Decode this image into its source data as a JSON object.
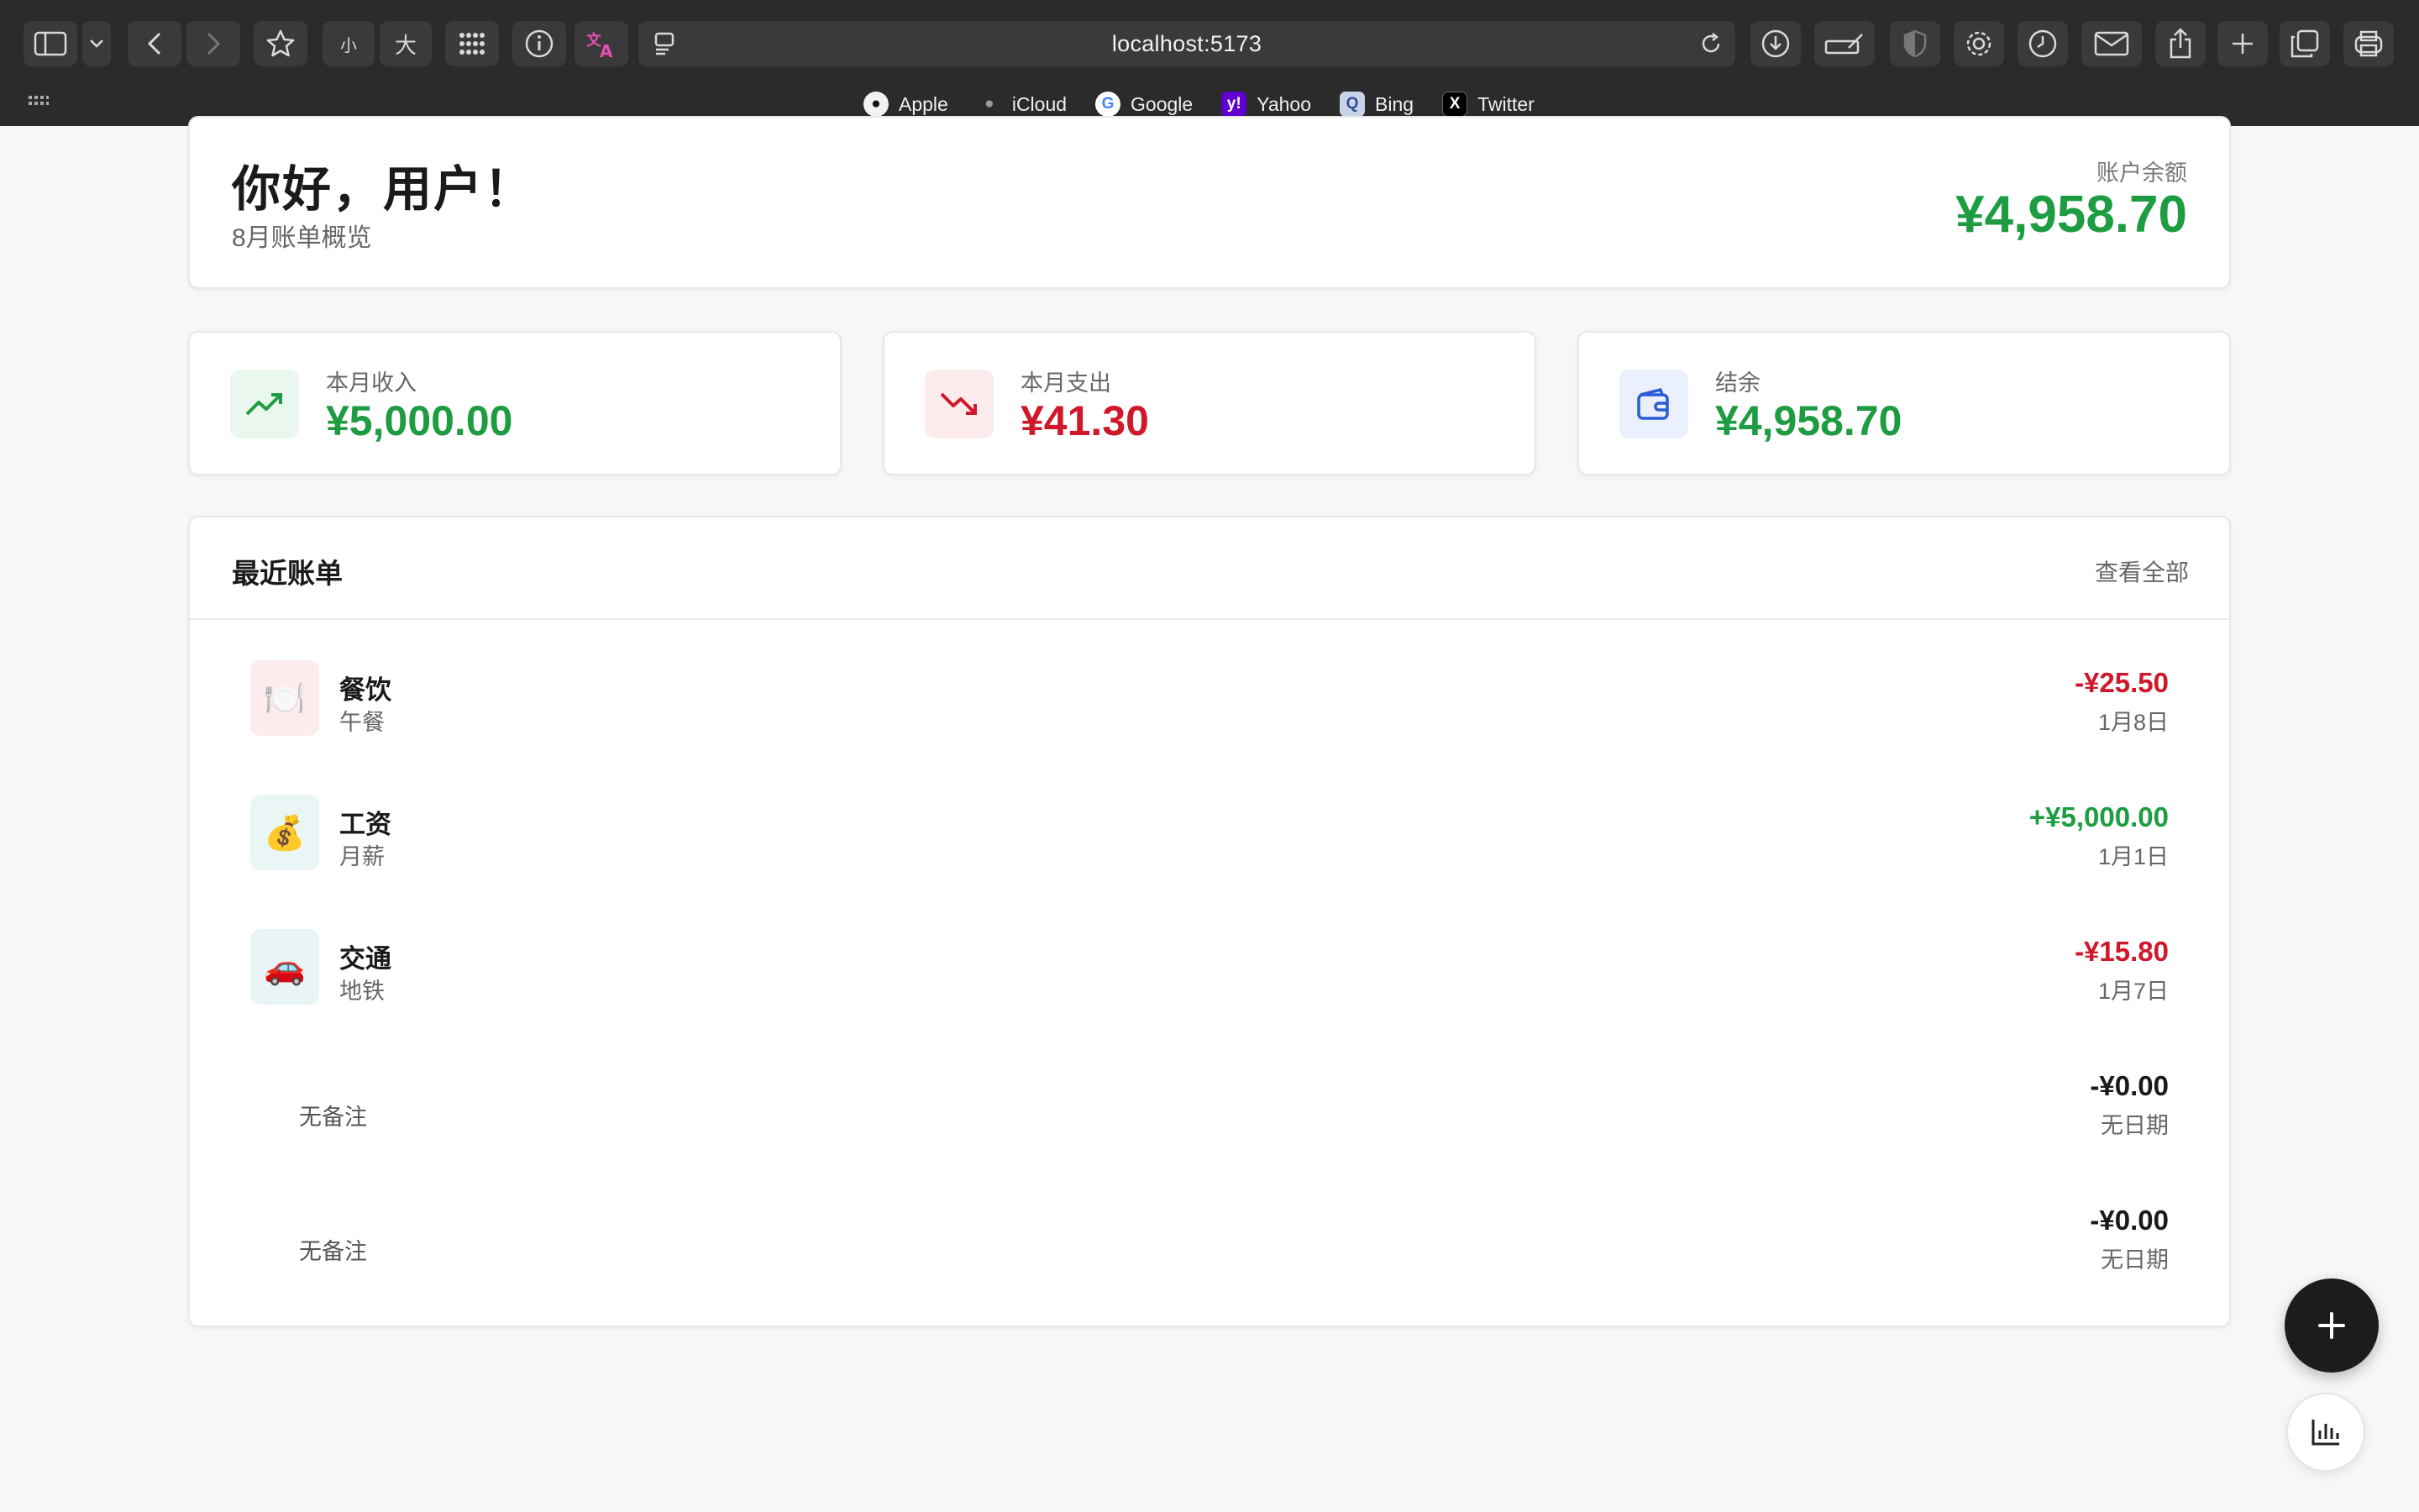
{
  "browser": {
    "url": "localhost:5173",
    "font_small_label": "小",
    "font_large_label": "大",
    "favorites": [
      {
        "label": "Apple",
        "icon": "apple-icon"
      },
      {
        "label": "iCloud",
        "icon": "apple-gray-icon"
      },
      {
        "label": "Google",
        "icon": "google-icon"
      },
      {
        "label": "Yahoo",
        "icon": "yahoo-icon"
      },
      {
        "label": "Bing",
        "icon": "bing-icon"
      },
      {
        "label": "Twitter",
        "icon": "x-icon"
      }
    ]
  },
  "header": {
    "greeting": "你好，用户！",
    "subtitle": "8月账单概览",
    "balance_label": "账户余额",
    "balance_value": "¥4,958.70"
  },
  "stats": [
    {
      "label": "本月收入",
      "value": "¥5,000.00",
      "icon": "trending-up-icon",
      "color": "#1e9c42",
      "bg": "#eaf7ee"
    },
    {
      "label": "本月支出",
      "value": "¥41.30",
      "icon": "trending-down-icon",
      "color": "#d0182b",
      "bg": "#fcebec"
    },
    {
      "label": "结余",
      "value": "¥4,958.70",
      "icon": "wallet-icon",
      "color": "#1e9c42",
      "bg": "#eaf0fd"
    }
  ],
  "recent": {
    "title": "最近账单",
    "view_all": "查看全部",
    "items": [
      {
        "category": "餐饮",
        "note": "午餐",
        "amount": "-¥25.50",
        "date": "1月8日",
        "emoji": "🍽️",
        "icon": "dining-icon",
        "amount_color": "#d0182b",
        "icon_bg": "#fdeced"
      },
      {
        "category": "工资",
        "note": "月薪",
        "amount": "+¥5,000.00",
        "date": "1月1日",
        "emoji": "💰",
        "icon": "money-bag-icon",
        "amount_color": "#1e9c42",
        "icon_bg": "#e9f6f5"
      },
      {
        "category": "交通",
        "note": "地铁",
        "amount": "-¥15.80",
        "date": "1月7日",
        "emoji": "🚗",
        "icon": "car-icon",
        "amount_color": "#d0182b",
        "icon_bg": "#e9f4f6"
      },
      {
        "category": "",
        "note": "无备注",
        "amount": "-¥0.00",
        "date": "无日期",
        "amount_color": "#1a1a1a"
      },
      {
        "category": "",
        "note": "无备注",
        "amount": "-¥0.00",
        "date": "无日期",
        "amount_color": "#1a1a1a"
      }
    ]
  },
  "actions": {
    "add_icon": "plus-icon",
    "stats_icon": "bar-chart-icon"
  }
}
